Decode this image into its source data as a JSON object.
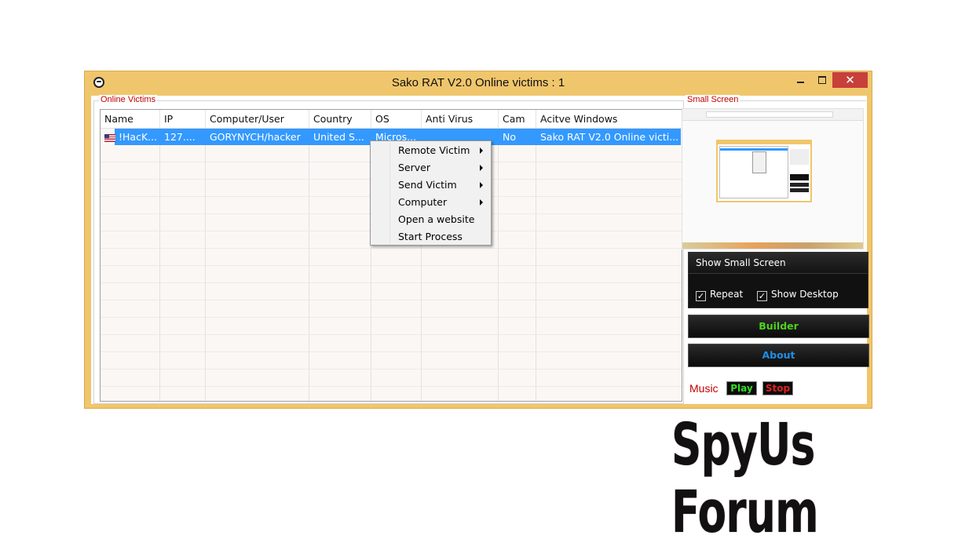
{
  "window": {
    "title": "Sako RAT V2.0 Online victims : 1",
    "close_glyph": "✕"
  },
  "victims_group": {
    "legend": "Online Victims",
    "columns": [
      "Name",
      "IP",
      "Computer/User",
      "Country",
      "OS",
      "Anti Virus",
      "Cam",
      "Acitve Windows"
    ],
    "rows": [
      {
        "name": "!HacK...",
        "ip": "127....",
        "computer_user": "GORYNYCH/hacker",
        "country": "United S...",
        "os": "Micros...",
        "anti_virus": "",
        "cam": "No",
        "active_window": "Sako RAT V2.0 Online victi..."
      }
    ]
  },
  "context_menu": {
    "items": [
      {
        "label": "Remote Victim",
        "submenu": true
      },
      {
        "label": "Server",
        "submenu": true
      },
      {
        "label": "Send Victim",
        "submenu": true
      },
      {
        "label": "Computer",
        "submenu": true
      },
      {
        "label": "Open a website",
        "submenu": false
      },
      {
        "label": "Start Process",
        "submenu": false
      }
    ]
  },
  "small_screen": {
    "legend": "Small Screen",
    "show_button": "Show Small Screen",
    "repeat_label": "Repeat",
    "repeat_checked": true,
    "show_desktop_label": "Show Desktop",
    "show_desktop_checked": true,
    "check_glyph": "✓"
  },
  "buttons": {
    "builder": "Builder",
    "about": "About",
    "builder_color": "#4cd31a",
    "about_color": "#1e8fe8"
  },
  "music": {
    "label": "Music",
    "play": "Play",
    "stop": "Stop",
    "play_color": "#33dd22",
    "stop_color": "#e02020"
  },
  "watermark": {
    "text": "SpyUs Forum"
  }
}
